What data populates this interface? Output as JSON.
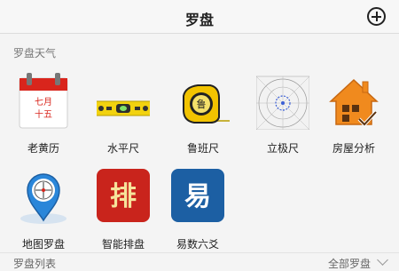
{
  "header": {
    "title": "罗盘"
  },
  "section": {
    "label": "罗盘天气"
  },
  "tools": [
    {
      "label": "老黄历",
      "icon": "calendar-icon",
      "cal_line1": "七月",
      "cal_line2": "十五"
    },
    {
      "label": "水平尺",
      "icon": "spirit-level-icon"
    },
    {
      "label": "鲁班尺",
      "icon": "tape-measure-icon",
      "glyph": "鲁"
    },
    {
      "label": "立极尺",
      "icon": "compass-grid-icon"
    },
    {
      "label": "房屋分析",
      "icon": "house-check-icon"
    },
    {
      "label": "地图罗盘",
      "icon": "map-compass-pin-icon"
    },
    {
      "label": "智能排盘",
      "icon": "pai-icon",
      "glyph": "排"
    },
    {
      "label": "易数六爻",
      "icon": "yi-icon",
      "glyph": "易"
    }
  ],
  "footer": {
    "left_label": "罗盘列表",
    "right_label": "全部罗盘"
  },
  "colors": {
    "calendar_red": "#d9251c",
    "level_yellow": "#f2d20f",
    "pai_red": "#c9241c",
    "yi_blue": "#1c5fa3",
    "house_orange": "#f08a1e"
  }
}
